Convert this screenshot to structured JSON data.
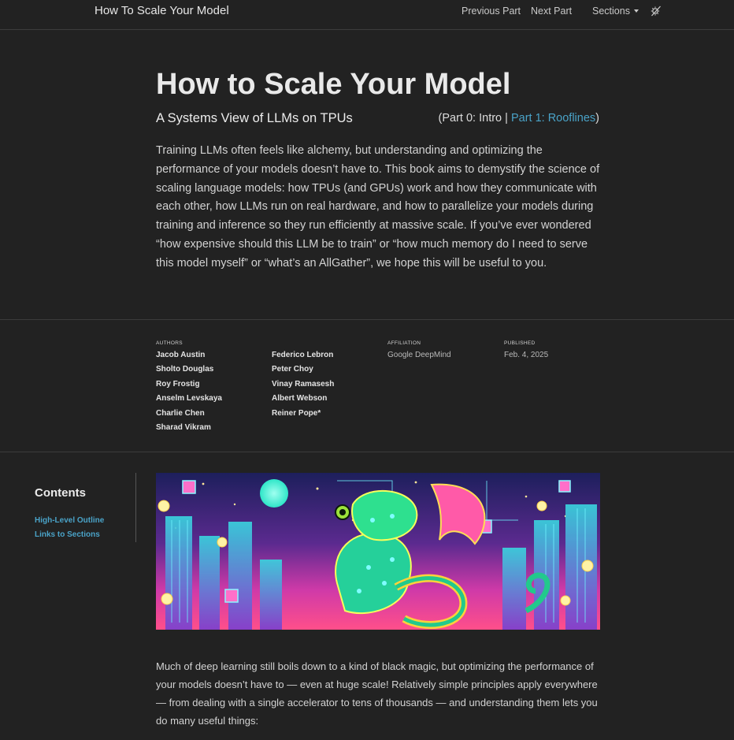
{
  "header": {
    "brand": "How To Scale Your Model",
    "prev_label": "Previous Part",
    "next_label": "Next Part",
    "sections_label": "Sections",
    "theme_icon": "theme-toggle-icon"
  },
  "article": {
    "title": "How to Scale Your Model",
    "subtitle": "A Systems View of LLMs on TPUs",
    "part_nav": {
      "open": "(Part 0: Intro | ",
      "link": "Part 1: Rooflines",
      "close": ")"
    },
    "abstract": "Training LLMs often feels like alchemy, but understanding and optimizing the performance of your models doesn’t have to. This book aims to demystify the science of scaling language models: how TPUs (and GPUs) work and how they communicate with each other, how LLMs run on real hardware, and how to parallelize your models during training and inference so they run efficiently at massive scale. If you’ve ever wondered “how expensive should this LLM be to train” or “how much memory do I need to serve this model myself” or “what’s an AllGather”, we hope this will be useful to you.",
    "body": "Much of deep learning still boils down to a kind of black magic, but optimizing the performance of your models doesn’t have to — even at huge scale! Relatively simple principles apply everywhere — from dealing with a single accelerator to tens of thousands — and understanding them lets you do many useful things:"
  },
  "byline": {
    "authors_heading": "AUTHORS",
    "authors_col1": [
      "Jacob Austin",
      "Sholto Douglas",
      "Roy Frostig",
      "Anselm Levskaya",
      "Charlie Chen",
      "Sharad Vikram"
    ],
    "authors_col2": [
      "Federico Lebron",
      "Peter Choy",
      "Vinay Ramasesh",
      "Albert Webson",
      "Reiner Pope*"
    ],
    "affiliation_heading": "AFFILIATION",
    "affiliation": "Google DeepMind",
    "published_heading": "PUBLISHED",
    "published": "Feb. 4, 2025"
  },
  "toc": {
    "title": "Contents",
    "items": [
      "High-Level Outline",
      "Links to Sections"
    ]
  },
  "colors": {
    "background": "#222222",
    "link": "#4aa3c8",
    "rule": "#3c3c3c"
  }
}
